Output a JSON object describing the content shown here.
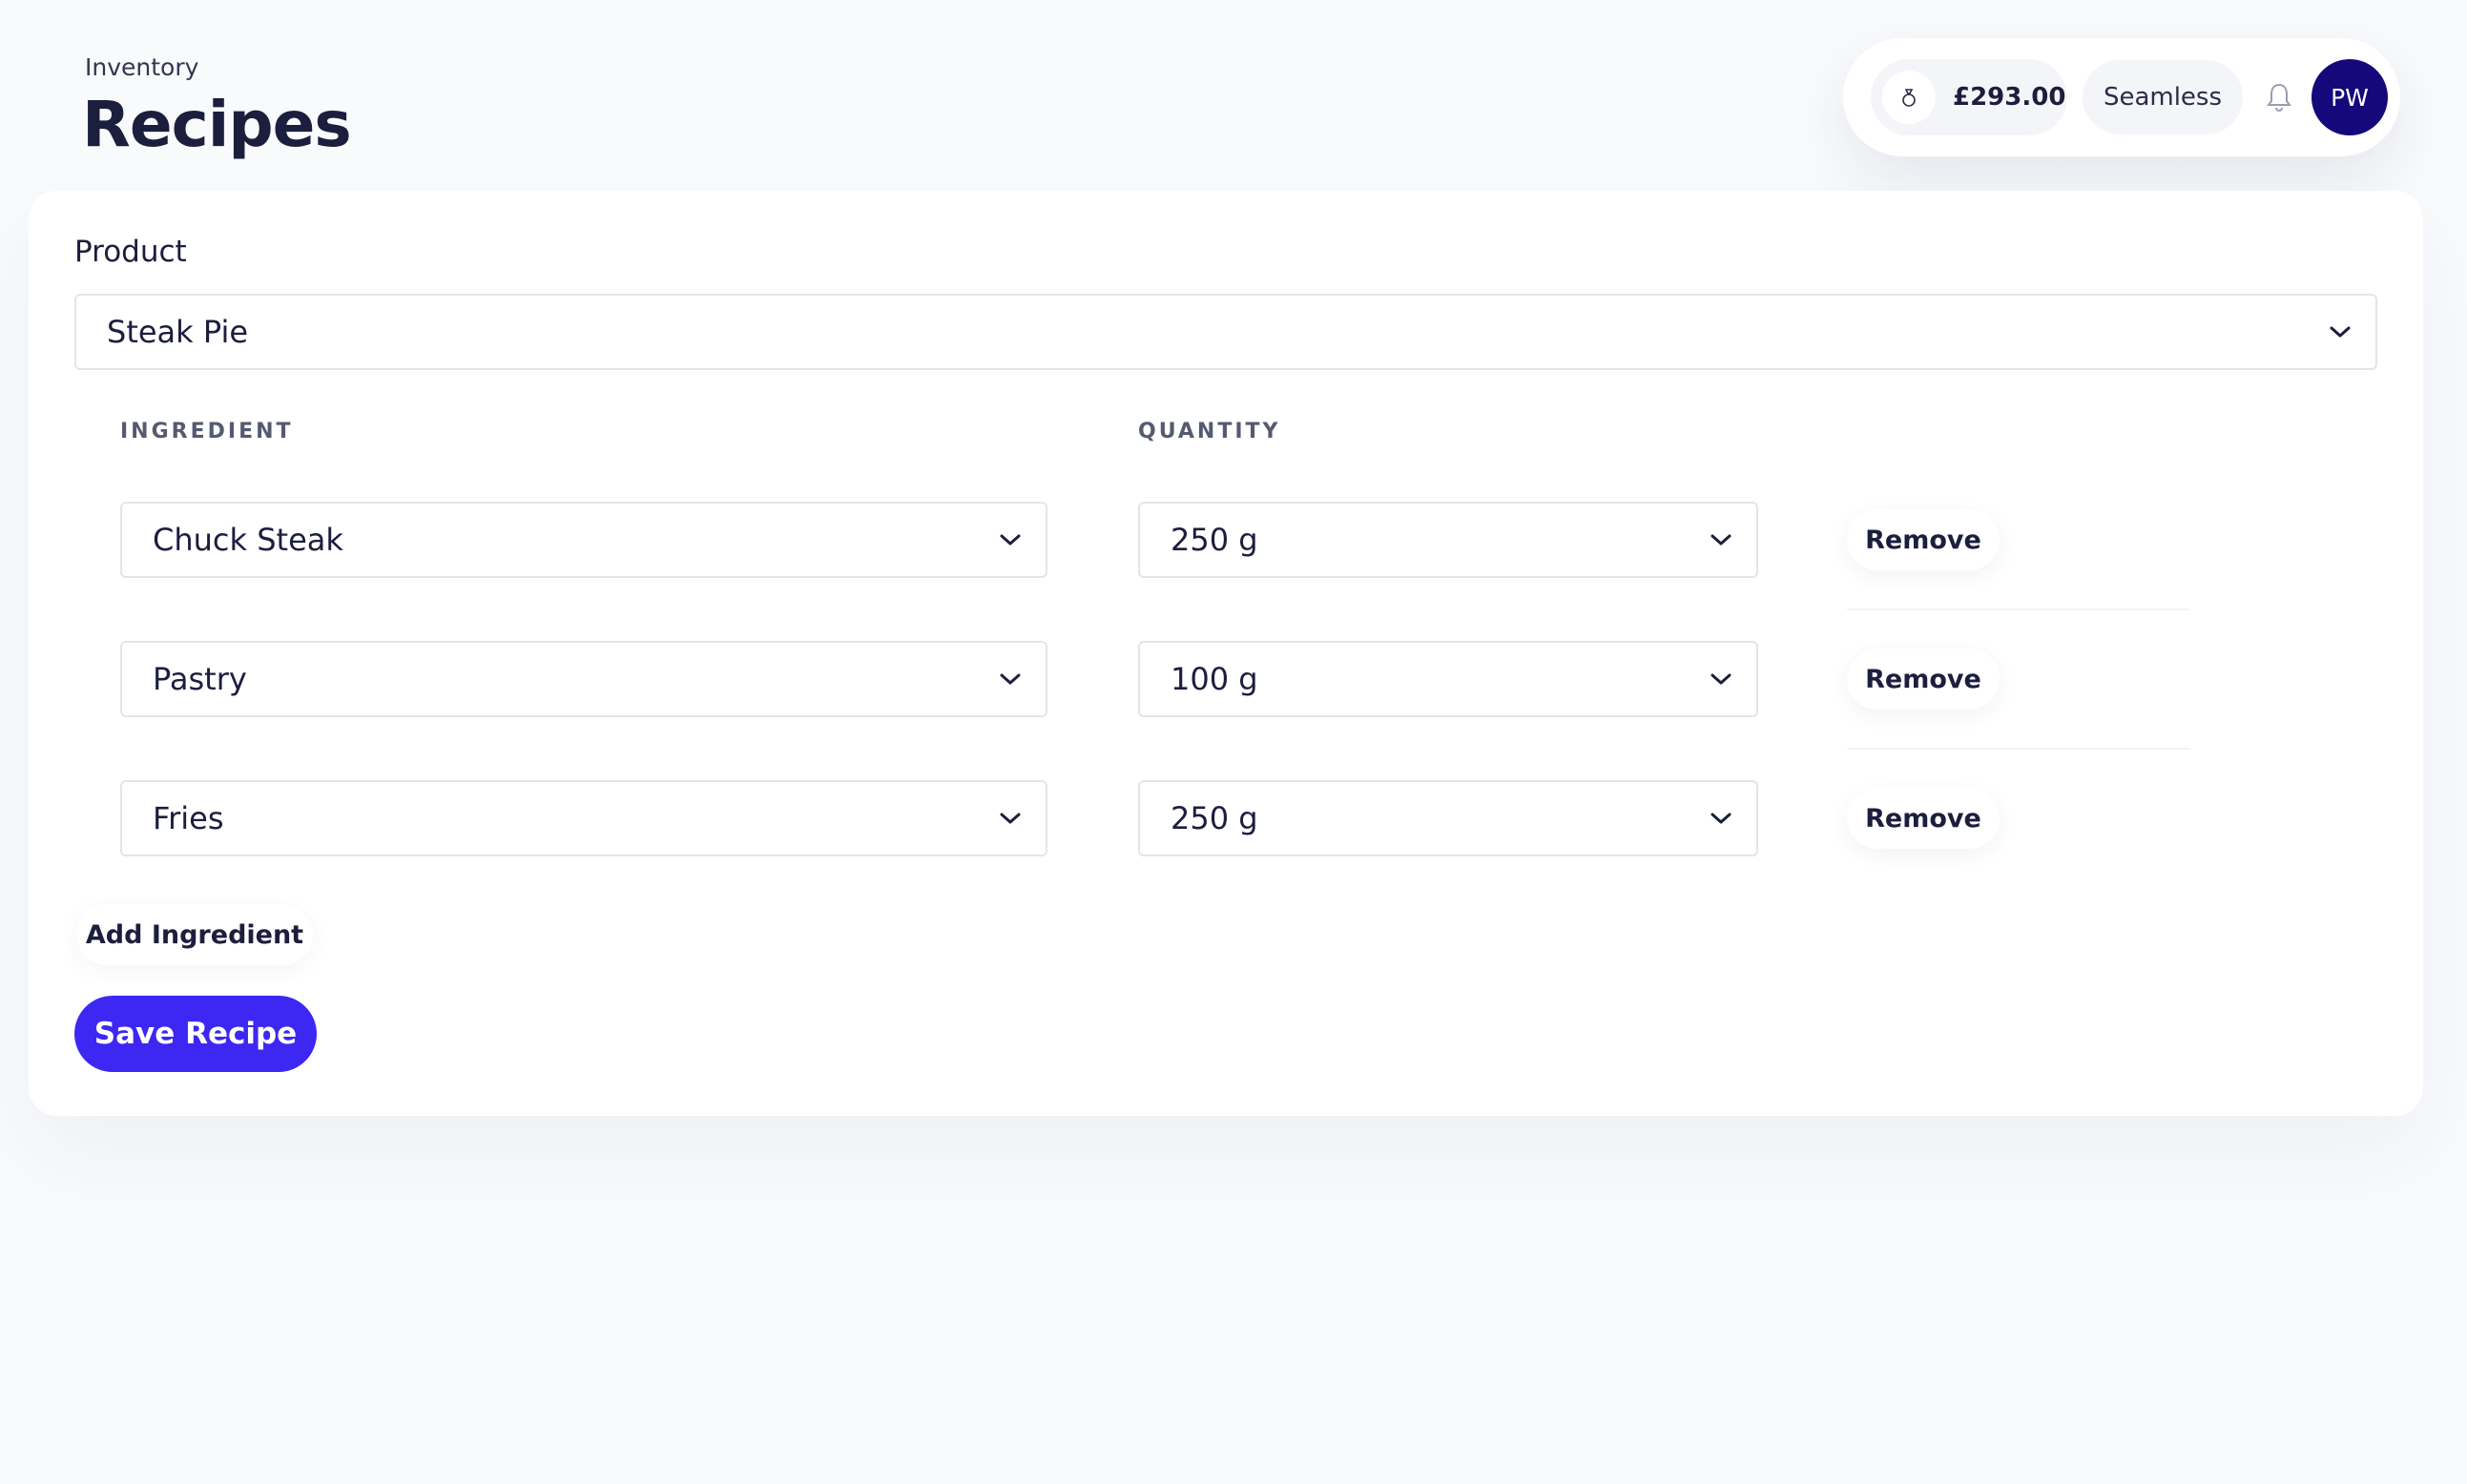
{
  "header": {
    "eyebrow": "Inventory",
    "title": "Recipes"
  },
  "topbar": {
    "balance": "£293.00",
    "mode": "Seamless",
    "avatar_initials": "PW"
  },
  "form": {
    "product_label": "Product",
    "product_value": "Steak Pie",
    "ingredient_header": "INGREDIENT",
    "quantity_header": "QUANTITY",
    "rows": [
      {
        "ingredient": "Chuck Steak",
        "quantity": "250 g",
        "remove_label": "Remove"
      },
      {
        "ingredient": "Pastry",
        "quantity": "100 g",
        "remove_label": "Remove"
      },
      {
        "ingredient": "Fries",
        "quantity": "250 g",
        "remove_label": "Remove"
      }
    ],
    "add_label": "Add Ingredient",
    "save_label": "Save Recipe"
  },
  "colors": {
    "primary": "#3d27f2",
    "avatar": "#15087a",
    "text": "#1b1e3d",
    "border": "#e3e5ec"
  }
}
